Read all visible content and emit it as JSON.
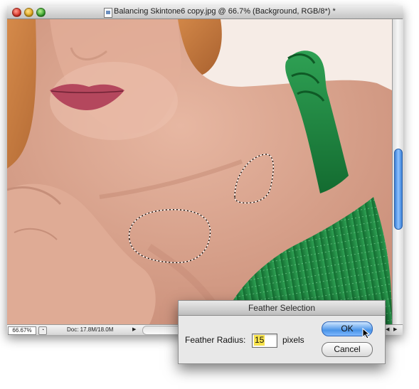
{
  "window": {
    "title": "Balancing Skintone6 copy.jpg @ 66.7% (Background, RGB/8*) *"
  },
  "statusbar": {
    "zoom": "66.67%",
    "doc_info": "Doc: 17.8M/18.0M",
    "arrow_right": "▶",
    "arrow_left": "◀"
  },
  "dialog": {
    "title": "Feather Selection",
    "radius_label": "Feather Radius:",
    "radius_value": "15",
    "units": "pixels",
    "ok_label": "OK",
    "cancel_label": "Cancel"
  },
  "colors": {
    "dress": "#1f8a3e",
    "skin": "#dba691",
    "accent_blue": "#4a94e8",
    "field_highlight": "#f7e24b"
  }
}
